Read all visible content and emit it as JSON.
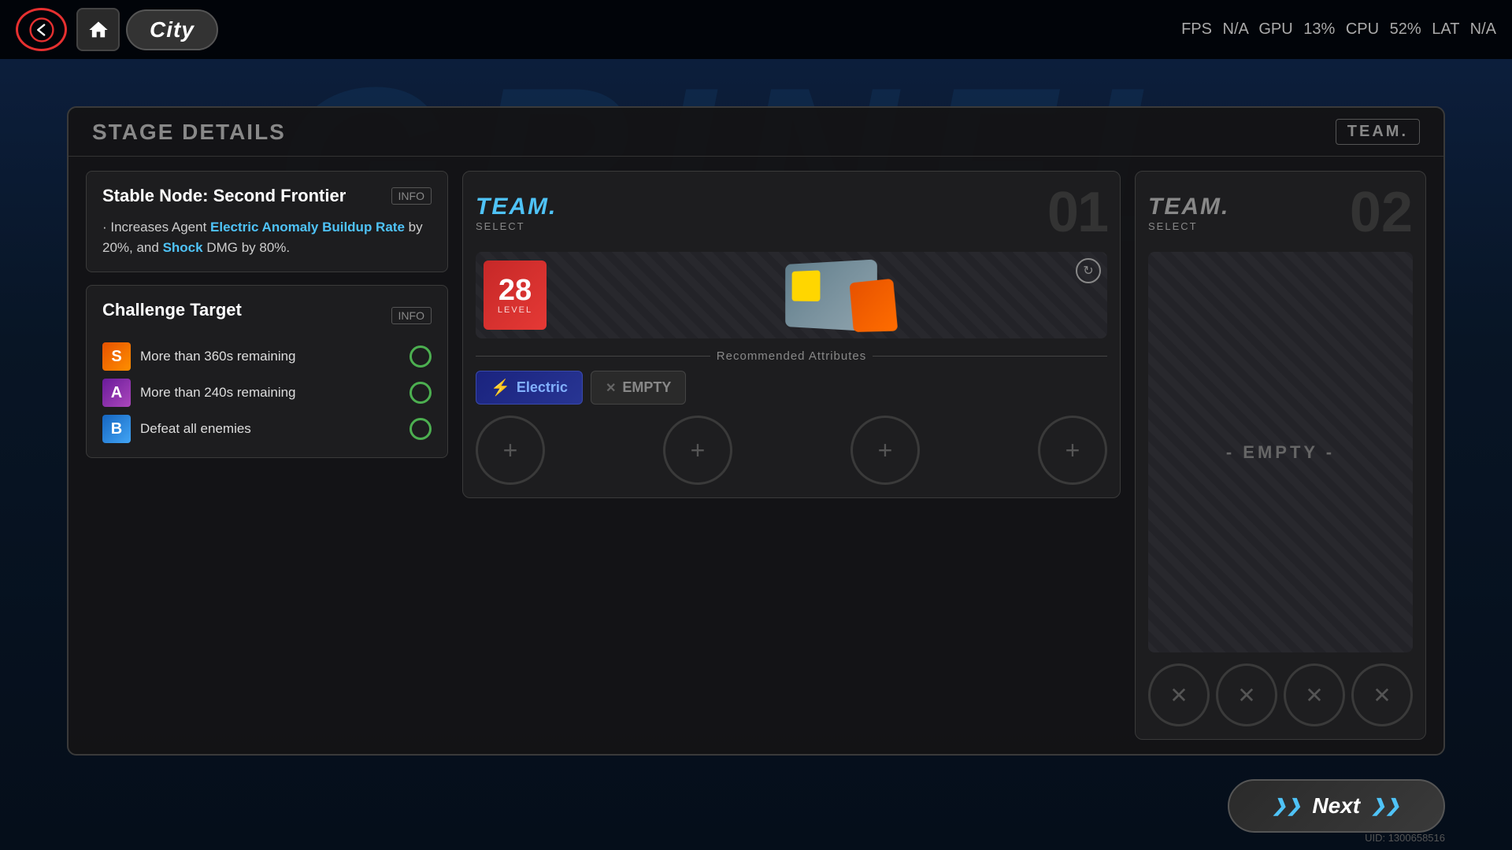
{
  "topbar": {
    "location": "City",
    "fps_label": "FPS",
    "fps_value": "N/A",
    "gpu_label": "GPU",
    "gpu_value": "13%",
    "cpu_label": "CPU",
    "cpu_value": "52%",
    "lat_label": "LAT",
    "lat_value": "N/A"
  },
  "panel": {
    "title": "Stage Details",
    "team_btn": "TEAM."
  },
  "stage": {
    "stable_node_title": "Stable Node: Second Frontier",
    "stable_node_tag": "INFO",
    "description_prefix": "· Increases Agent ",
    "description_highlight1": "Electric Anomaly Buildup Rate",
    "description_mid": " by 20%, and ",
    "description_highlight2": "Shock",
    "description_suffix": " DMG by 80%.",
    "challenge_title": "Challenge Target",
    "challenge_tag": "INFO",
    "challenges": [
      {
        "rank": "S",
        "rank_class": "rank-s",
        "text": "More than 360s remaining"
      },
      {
        "rank": "A",
        "rank_class": "rank-a",
        "text": "More than 240s remaining"
      },
      {
        "rank": "B",
        "rank_class": "rank-b",
        "text": "Defeat all enemies"
      }
    ]
  },
  "team1": {
    "label": "TEAM.",
    "select_label": "SELECT",
    "number": "01",
    "character_level": "28",
    "level_text": "LEVEL",
    "recommended_label": "Recommended Attributes",
    "attributes": [
      {
        "type": "electric",
        "label": "Electric"
      },
      {
        "type": "empty",
        "label": "EMPTY"
      }
    ],
    "add_buttons": [
      "+",
      "+",
      "+",
      "+"
    ]
  },
  "team2": {
    "label": "TEAM.",
    "select_label": "SELECT",
    "number": "02",
    "empty_text": "- EMPTY -",
    "x_buttons": [
      "✕",
      "✕",
      "✕",
      "✕"
    ]
  },
  "next_button": {
    "label": "Next"
  },
  "uid": {
    "text": "UID: 1300658516"
  }
}
